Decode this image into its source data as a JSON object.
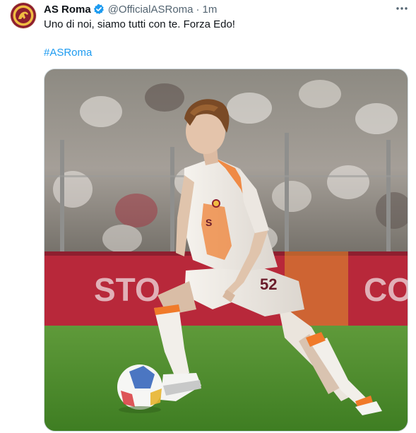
{
  "tweet": {
    "author_name": "AS Roma",
    "handle": "@OfficialASRoma",
    "separator": "·",
    "time": "1m",
    "text": "Uno di noi, siamo tutti con te. Forza Edo!",
    "hashtag": "#ASRoma",
    "more_icon": "more-horizontal-icon",
    "verified_icon": "verified-badge-icon",
    "media": {
      "banner_text_left": "STO",
      "banner_text_right": "CO",
      "jersey_number": "52"
    }
  },
  "colors": {
    "brand_red": "#8e1f2f",
    "brand_gold": "#f0bc42",
    "link_blue": "#1d9bf0",
    "verified_blue": "#1d9bf0",
    "banner_red": "#b8283a",
    "jersey_orange": "#f07a2a"
  }
}
